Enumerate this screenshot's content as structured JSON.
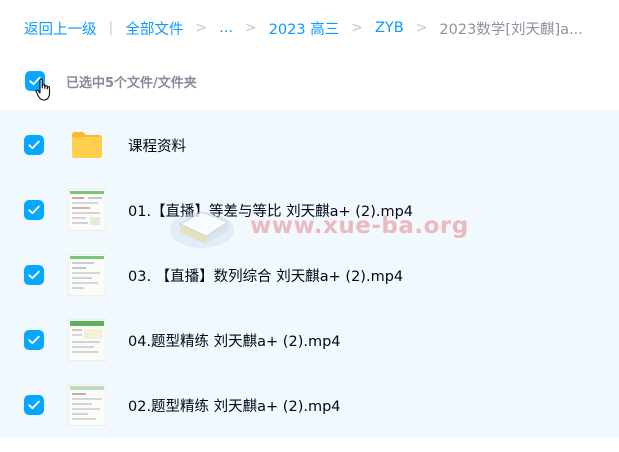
{
  "breadcrumb": {
    "back": "返回上一级",
    "divider": "|",
    "all_files": "全部文件",
    "sep": ">",
    "ellipsis": "...",
    "level1": "2023 高三",
    "level2": "ZYB",
    "current": "2023数学[刘天麒]a..."
  },
  "selection": {
    "text": "已选中5个文件/文件夹",
    "checked": true
  },
  "files": [
    {
      "name": "课程资料",
      "type": "folder",
      "checked": true
    },
    {
      "name": "01.【直播】等差与等比 刘天麒a+ (2).mp4",
      "type": "video",
      "checked": true
    },
    {
      "name": "03. 【直播】数列综合 刘天麒a+ (2).mp4",
      "type": "video",
      "checked": true
    },
    {
      "name": "04.题型精练 刘天麒a+ (2).mp4",
      "type": "video",
      "checked": true
    },
    {
      "name": "02.题型精练 刘天麒a+ (2).mp4",
      "type": "video",
      "checked": true
    }
  ],
  "watermark": "www.xue-ba.org",
  "colors": {
    "accent": "#06a7ff",
    "link": "#0d99ff",
    "list_bg": "#f1f8fe",
    "folder": "#ffc53d"
  },
  "icons": {
    "check": "check-icon",
    "folder": "folder-icon",
    "video": "video-thumbnail",
    "cursor": "hand-cursor-icon"
  }
}
